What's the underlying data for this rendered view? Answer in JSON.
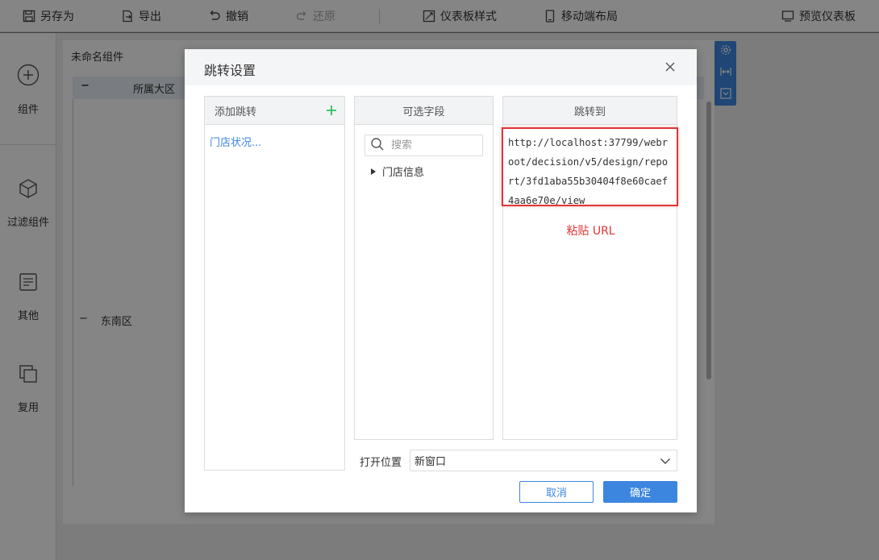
{
  "toolbar": {
    "save_as": "另存为",
    "export": "导出",
    "undo": "撤销",
    "redo": "还原",
    "dashboard_style": "仪表板样式",
    "mobile_layout": "移动端布局",
    "preview": "预览仪表板"
  },
  "leftbar": {
    "items": [
      {
        "label": "组件",
        "icon": "plus-circle-icon"
      },
      {
        "label": "过滤组件",
        "icon": "cube-icon"
      },
      {
        "label": "其他",
        "icon": "document-icon"
      },
      {
        "label": "复用",
        "icon": "layers-icon"
      }
    ]
  },
  "widget": {
    "title": "未命名组件",
    "header_minus": "−",
    "header_label": "所属大区",
    "row_minus": "−",
    "row_label": "东南区"
  },
  "dialog": {
    "title": "跳转设置",
    "panel_add_jump": "添加跳转",
    "jump_item": "门店状况...",
    "panel_fields": "可选字段",
    "search_placeholder": "搜索",
    "tree_node": "门店信息",
    "panel_jump_to": "跳转到",
    "url": "http://localhost:37799/webroot/decision/v5/design/report/3fd1aba55b30404f8e60caef4aa6e70e/view",
    "paste_note": "粘贴 URL",
    "open_position_label": "打开位置",
    "open_position_value": "新窗口",
    "cancel": "取消",
    "confirm": "确定"
  },
  "colors": {
    "accent": "#3d86e0",
    "highlight": "#e03535",
    "add": "#2fbf5a"
  }
}
